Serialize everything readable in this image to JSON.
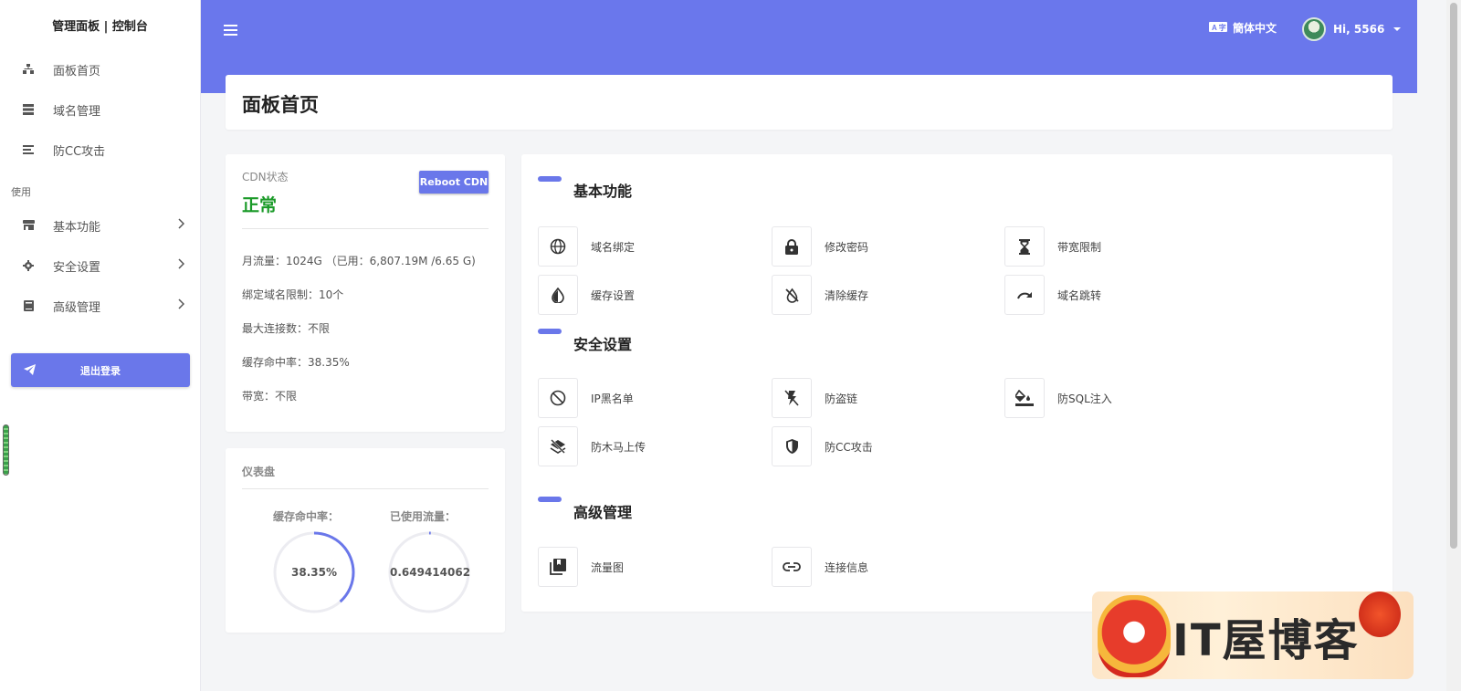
{
  "sidebar": {
    "brand": "管理面板 | 控制台",
    "top_items": [
      {
        "label": "面板首页",
        "icon": "sitemap-icon"
      },
      {
        "label": "域名管理",
        "icon": "server-icon"
      },
      {
        "label": "防CC攻击",
        "icon": "list-icon"
      }
    ],
    "section_label": "使用",
    "menu_items": [
      {
        "label": "基本功能",
        "icon": "store-icon"
      },
      {
        "label": "安全设置",
        "icon": "gear-icon"
      },
      {
        "label": "高级管理",
        "icon": "book-icon"
      }
    ],
    "logout_label": "退出登录"
  },
  "topbar": {
    "language": "簡体中文",
    "greeting": "Hi, 5566"
  },
  "header": {
    "title": "面板首页"
  },
  "cdn": {
    "label": "CDN状态",
    "status": "正常",
    "reboot_label": "Reboot CDN",
    "stats": [
      "月流量：1024G （已用：6,807.19M /6.65 G)",
      "绑定域名限制：10个",
      "最大连接数：不限",
      "缓存命中率：38.35%",
      "带宽：不限"
    ]
  },
  "dashboard": {
    "title": "仪表盘",
    "gauges": [
      {
        "label": "缓存命中率：",
        "value_text": "38.35%",
        "fraction": 0.3835
      },
      {
        "label": "已使用流量：",
        "value_text": "0.6494140625%",
        "fraction": 0.006494
      }
    ],
    "accent": "#6a77ea"
  },
  "features": {
    "sections": [
      {
        "title": "基本功能",
        "tiles": [
          {
            "label": "域名绑定",
            "icon": "globe-icon"
          },
          {
            "label": "修改密码",
            "icon": "lock-icon"
          },
          {
            "label": "带宽限制",
            "icon": "hourglass-icon"
          },
          {
            "label": "缓存设置",
            "icon": "droplet-icon"
          },
          {
            "label": "清除缓存",
            "icon": "droplet-off-icon"
          },
          {
            "label": "域名跳转",
            "icon": "redo-icon"
          }
        ]
      },
      {
        "title": "安全设置",
        "tiles": [
          {
            "label": "IP黑名单",
            "icon": "block-icon"
          },
          {
            "label": "防盗链",
            "icon": "flash-off-icon"
          },
          {
            "label": "防SQL注入",
            "icon": "paint-bucket-icon"
          },
          {
            "label": "防木马上传",
            "icon": "layers-off-icon"
          },
          {
            "label": "防CC攻击",
            "icon": "shield-icon"
          }
        ]
      },
      {
        "title": "高级管理",
        "tiles": [
          {
            "label": "流量图",
            "icon": "library-icon"
          },
          {
            "label": "连接信息",
            "icon": "link-icon"
          }
        ]
      }
    ]
  },
  "watermark": {
    "text": "IT屋博客"
  },
  "colors": {
    "primary": "#6a77ec",
    "status_ok": "#1a9a28"
  }
}
